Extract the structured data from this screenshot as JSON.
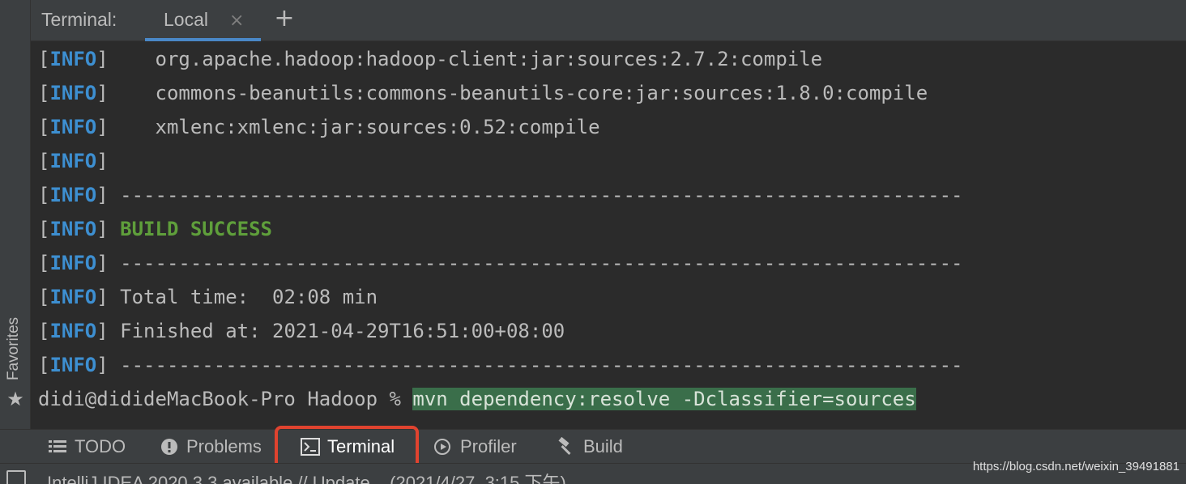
{
  "header": {
    "title": "Terminal:",
    "tab_label": "Local",
    "close_glyph": "×",
    "add_glyph": "+"
  },
  "sidebar": {
    "favorites_label": "Favorites"
  },
  "terminal": {
    "info_tag": "INFO",
    "lines": [
      "   org.apache.hadoop:hadoop-client:jar:sources:2.7.2:compile",
      "   commons-beanutils:commons-beanutils-core:jar:sources:1.8.0:compile",
      "   xmlenc:xmlenc:jar:sources:0.52:compile",
      "",
      "------------------------------------------------------------------------",
      "BUILD SUCCESS",
      "------------------------------------------------------------------------",
      "Total time:  02:08 min",
      "Finished at: 2021-04-29T16:51:00+08:00",
      "------------------------------------------------------------------------"
    ],
    "prompt": "didi@dididеMacBook-Pro Hadoop % ",
    "command": "mvn dependency:resolve -Dclassifier=sources"
  },
  "toolbar": {
    "items": [
      {
        "label": "TODO",
        "icon": "list-icon"
      },
      {
        "label": "Problems",
        "icon": "alert-icon"
      },
      {
        "label": "Terminal",
        "icon": "terminal-icon"
      },
      {
        "label": "Profiler",
        "icon": "profiler-icon"
      },
      {
        "label": "Build",
        "icon": "hammer-icon"
      }
    ]
  },
  "status": {
    "text": "IntelliJ IDEA 2020.3.3 available // Update... (2021/4/27, 3:15 下午)",
    "watermark": "https://blog.csdn.net/weixin_39491881"
  },
  "colors": {
    "info": "#3d8fd1",
    "success": "#5f9f3b",
    "command_bg": "#3a6e4a",
    "highlight": "#e0432f",
    "tab_underline": "#4a88c7"
  }
}
